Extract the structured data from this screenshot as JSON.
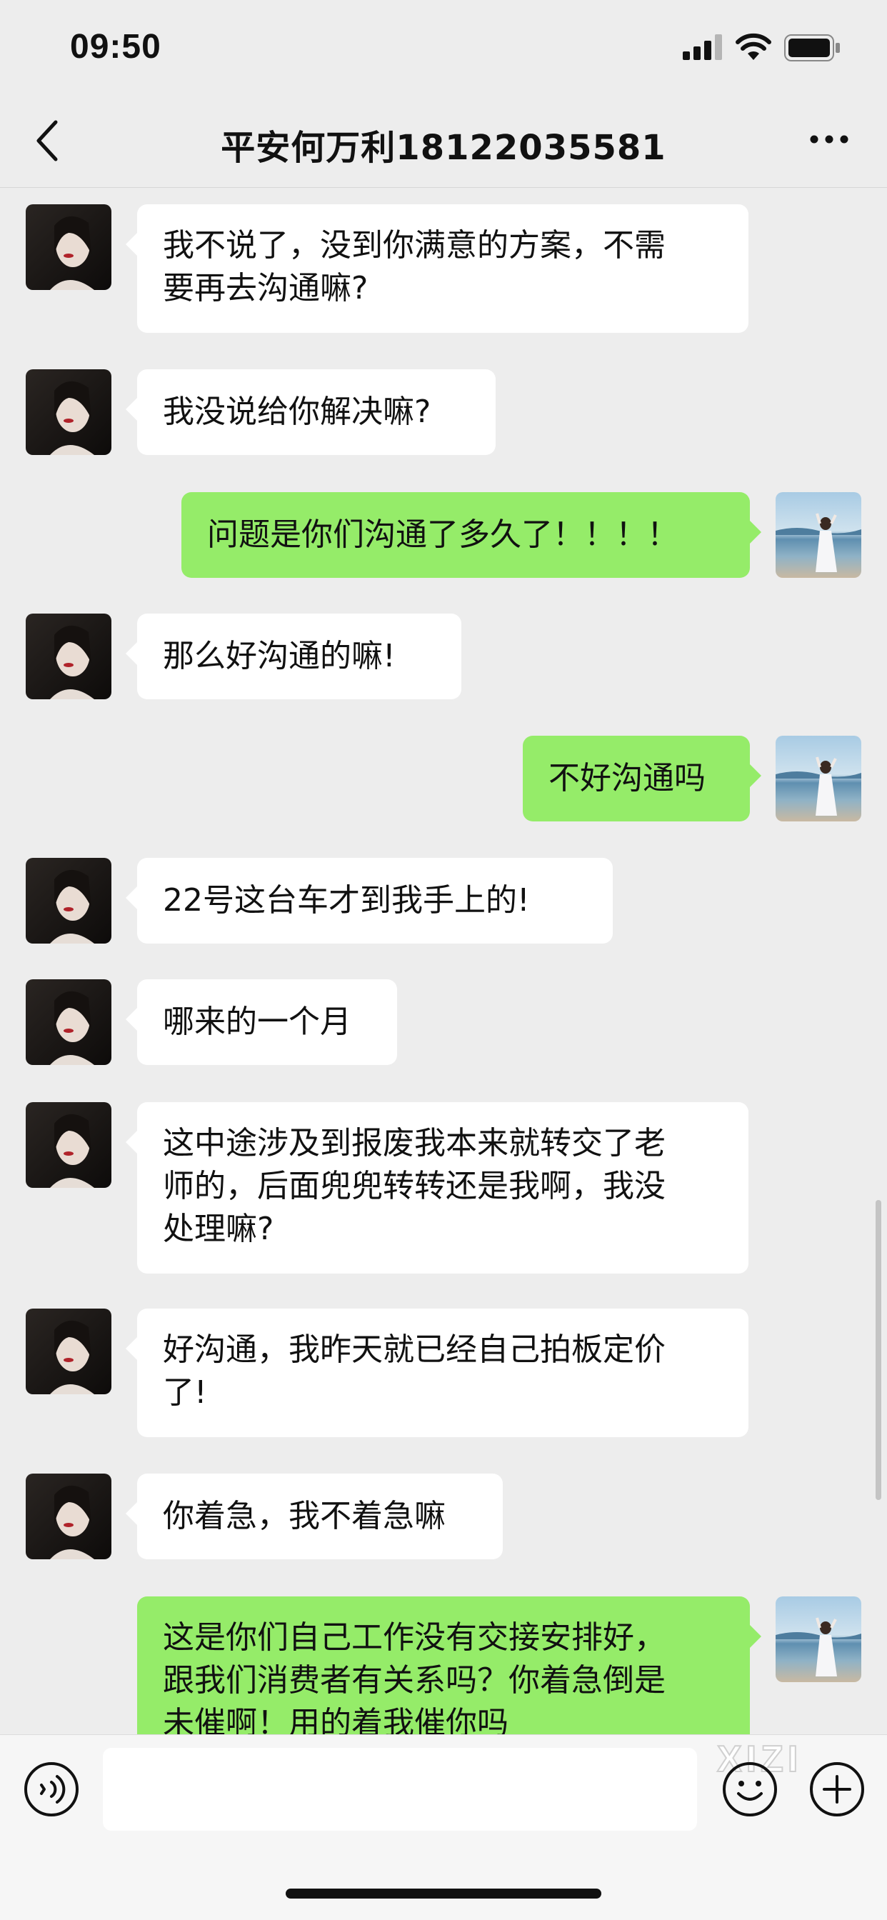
{
  "status_bar": {
    "time": "09:50"
  },
  "nav": {
    "title": "平安何万利18122035581"
  },
  "messages": [
    {
      "from": "other",
      "text": "我不说了，没到你满意的方案，不需\n要再去沟通嘛?"
    },
    {
      "from": "other",
      "text": "我没说给你解决嘛?"
    },
    {
      "from": "me",
      "text": "问题是你们沟通了多久了！！！！"
    },
    {
      "from": "other",
      "text": "那么好沟通的嘛!"
    },
    {
      "from": "me",
      "text": "不好沟通吗"
    },
    {
      "from": "other",
      "text": "22号这台车才到我手上的!"
    },
    {
      "from": "other",
      "text": "哪来的一个月"
    },
    {
      "from": "other",
      "text": "这中途涉及到报废我本来就转交了老\n师的，后面兜兜转转还是我啊，我没\n处理嘛?"
    },
    {
      "from": "other",
      "text": "好沟通，我昨天就已经自己拍板定价\n了!"
    },
    {
      "from": "other",
      "text": "你着急，我不着急嘛"
    },
    {
      "from": "me",
      "text": "这是你们自己工作没有交接安排好，\n跟我们消费者有关系吗？你着急倒是\n未催啊！用的着我催你吗"
    }
  ],
  "input_bar": {
    "watermark": "XIZI"
  },
  "colors": {
    "background": "#ededed",
    "outgoing_bubble": "#95ec69",
    "incoming_bubble": "#ffffff"
  },
  "icons": [
    "back-arrow-icon",
    "more-icon",
    "voice-icon",
    "emoji-icon",
    "plus-icon",
    "signal-icon",
    "wifi-icon",
    "battery-icon"
  ]
}
